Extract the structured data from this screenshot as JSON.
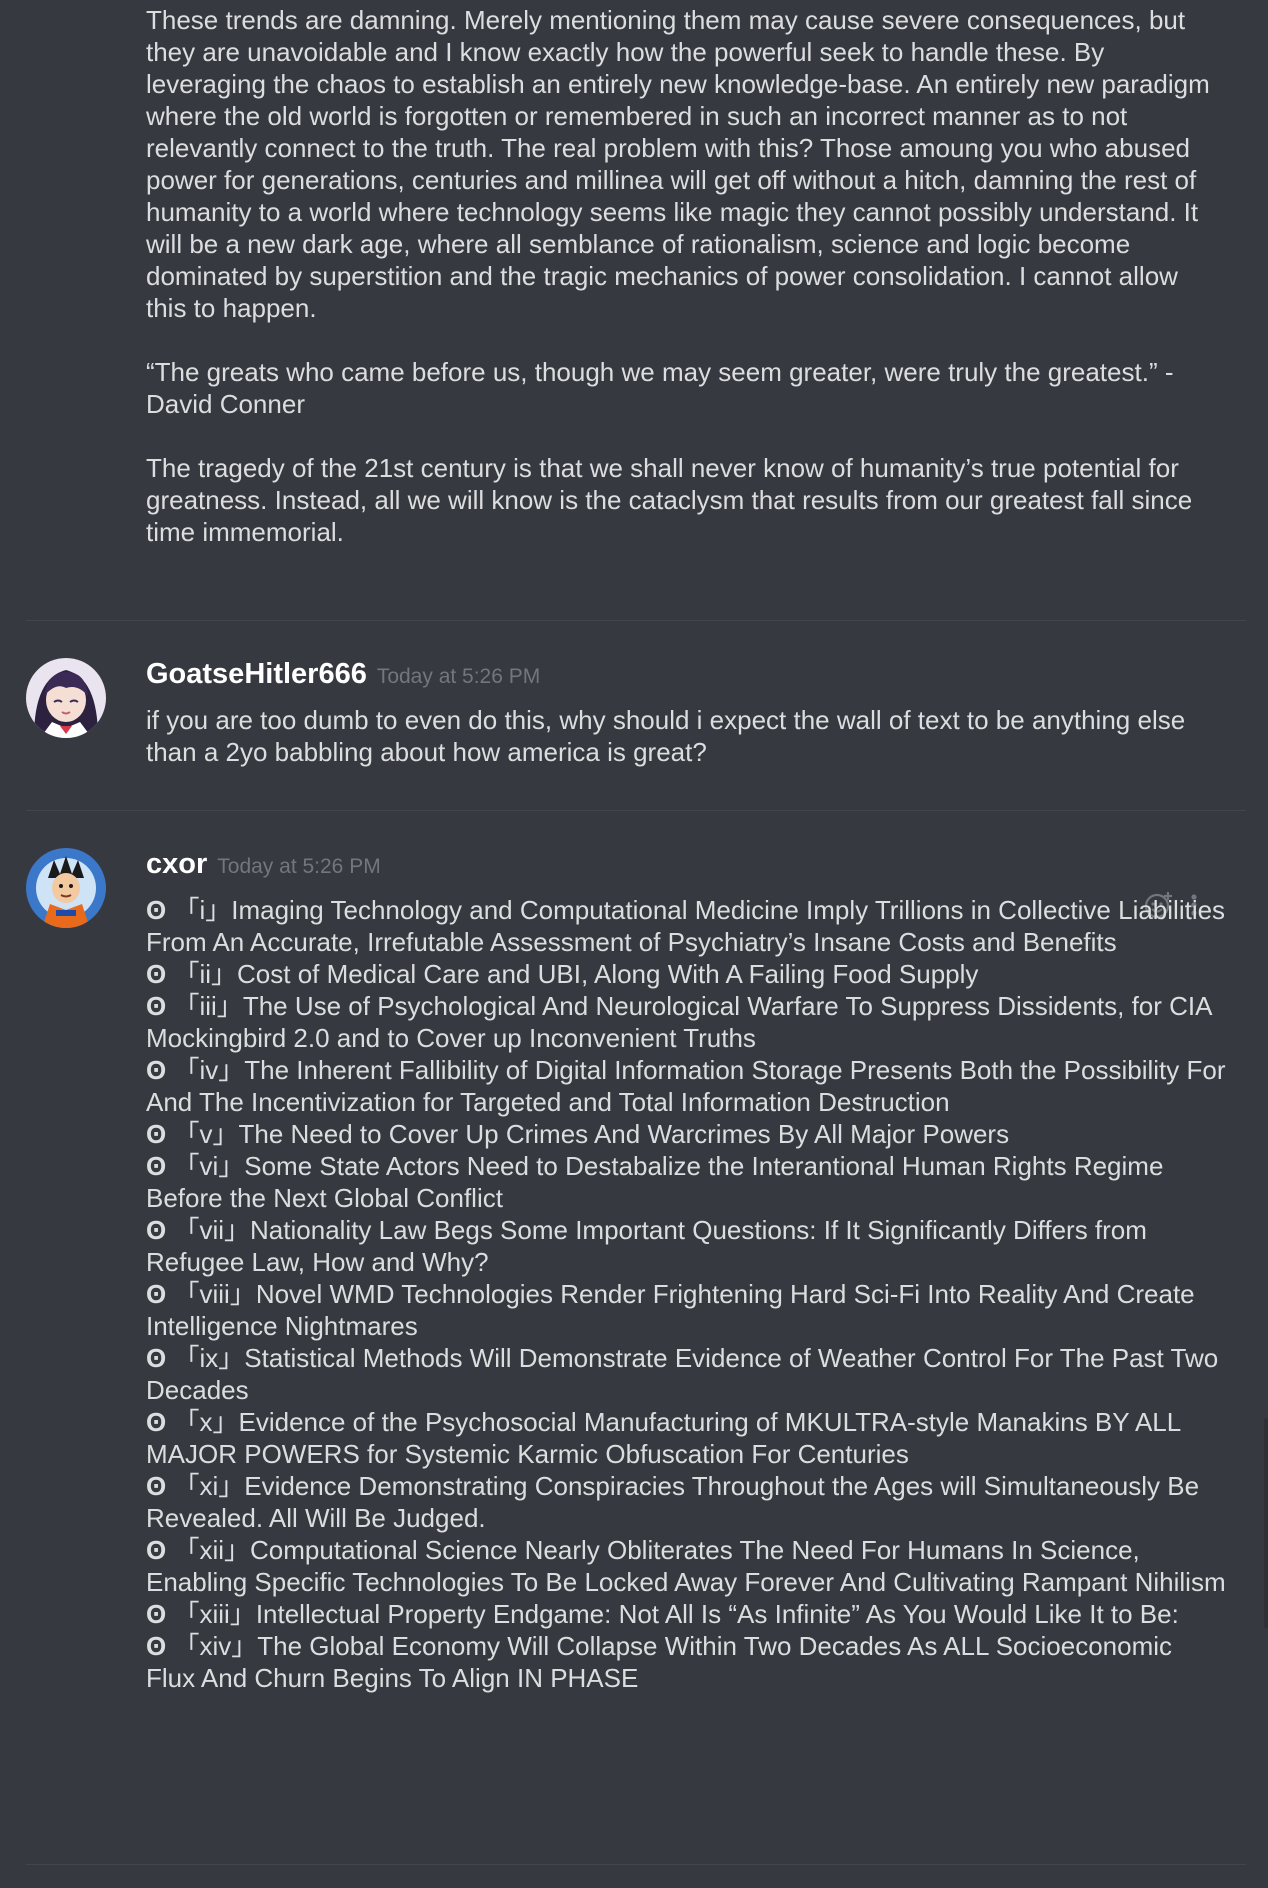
{
  "colors": {
    "background": "#36393f",
    "text": "#dcddde",
    "username": "#ffffff",
    "timestamp": "#72767d",
    "divider": "#42454a"
  },
  "continued_message": {
    "paragraphs": [
      "These trends are damning. Merely mentioning them may cause severe consequences, but they are unavoidable and I know exactly how the powerful seek to handle these. By leveraging the chaos to establish an entirely new knowledge-base. An entirely new paradigm where the old world is forgotten or remembered in such an incorrect manner as to not relevantly connect to the truth. The real problem with this? Those amoung you who abused power for generations, centuries and millinea will get off without a hitch, damning the rest of humanity to a world where technology seems like magic they cannot possibly understand. It will be a new dark age, where all semblance of rationalism, science and logic become dominated by superstition and the tragic mechanics of power consolidation. I cannot allow this to happen.",
      "“The greats who came before us, though we may seem greater, were truly the greatest.” - David Conner",
      "The tragedy of the 21st century is that we shall never know of humanity’s true potential for greatness. Instead, all we will know is the cataclysm that results from our greatest fall since time immemorial."
    ]
  },
  "messages": [
    {
      "username": "GoatseHitler666",
      "timestamp": "Today at 5:26 PM",
      "text": "if you are too dumb to even do this, why should i expect the wall of text to be anything else than a 2yo babbling about how america is great?",
      "avatar_icon": "anime-girl-avatar"
    },
    {
      "username": "cxor",
      "timestamp": "Today at 5:26 PM",
      "avatar_icon": "cartoon-fighter-avatar",
      "bullet": "ʘ",
      "items": [
        {
          "num": "「i」",
          "text": "Imaging Technology and Computational Medicine Imply Trillions in Collective Liabilities From An Accurate, Irrefutable Assessment of Psychiatry’s Insane Costs and Benefits"
        },
        {
          "num": "「ii」",
          "text": "Cost of Medical Care and UBI, Along With A Failing Food Supply"
        },
        {
          "num": "「iii」",
          "text": "The Use of Psychological And Neurological Warfare To Suppress Dissidents, for CIA Mockingbird 2.0 and to Cover up Inconvenient Truths"
        },
        {
          "num": "「iv」",
          "text": "The Inherent Fallibility of Digital Information Storage Presents Both the Possibility For And The Incentivization for Targeted and Total Information Destruction"
        },
        {
          "num": "「v」",
          "text": "The Need to Cover Up Crimes And Warcrimes By All Major Powers"
        },
        {
          "num": "「vi」",
          "text": "Some State Actors Need to Destabalize the Interantional Human Rights Regime Before the Next Global Conflict"
        },
        {
          "num": "「vii」",
          "text": "Nationality Law Begs Some Important Questions: If It Significantly Differs from Refugee Law, How and Why?"
        },
        {
          "num": "「viii」",
          "text": "Novel WMD Technologies Render Frightening Hard Sci-Fi Into Reality And Create Intelligence Nightmares"
        },
        {
          "num": "「ix」",
          "text": "Statistical Methods Will Demonstrate Evidence of Weather Control For The Past Two Decades"
        },
        {
          "num": "「x」",
          "text": "Evidence of the Psychosocial Manufacturing of MKULTRA-style Manakins BY ALL MAJOR POWERS for Systemic Karmic Obfuscation For Centuries"
        },
        {
          "num": "「xi」",
          "text": "Evidence Demonstrating Conspiracies Throughout the Ages will Simultaneously Be Revealed. All Will Be Judged."
        },
        {
          "num": "「xii」",
          "text": "Computational Science Nearly Obliterates The Need For Humans In Science, Enabling Specific Technologies To Be Locked Away Forever And Cultivating Rampant Nihilism"
        },
        {
          "num": "「xiii」",
          "text": "Intellectual Property Endgame: Not All Is “As Infinite” As You Would Like It to Be:"
        },
        {
          "num": "「xiv」",
          "text": "The Global Economy Will Collapse Within Two Decades As ALL Socioeconomic Flux And Churn Begins To Align IN PHASE"
        }
      ],
      "actions": [
        "add-reaction-icon",
        "more-options-icon"
      ]
    }
  ]
}
